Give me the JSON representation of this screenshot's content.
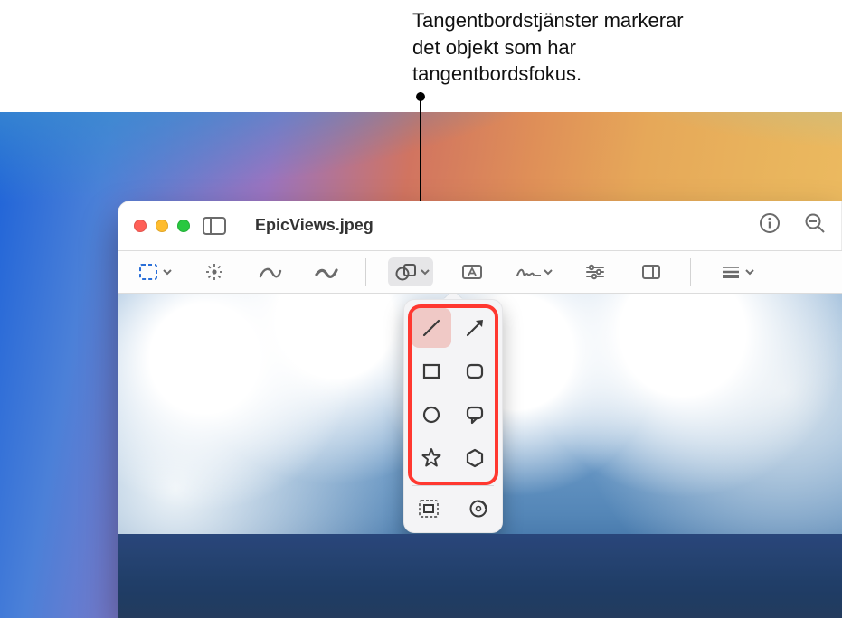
{
  "callout": {
    "text": "Tangentbordstjänster markerar det objekt som har tangentbordsfokus."
  },
  "window": {
    "title": "EpicViews.jpeg",
    "traffic": {
      "close": "close",
      "minimize": "minimize",
      "zoom": "zoom"
    },
    "sidebar_button": "sidebar",
    "info_button": "info",
    "zoom_out_button": "zoom-out"
  },
  "markup": {
    "items": [
      {
        "name": "selection-tool",
        "has_chevron": true
      },
      {
        "name": "instant-alpha-tool",
        "has_chevron": false
      },
      {
        "name": "sketch-tool",
        "has_chevron": false
      },
      {
        "name": "draw-tool",
        "has_chevron": false
      },
      {
        "name": "shapes-tool",
        "has_chevron": true,
        "active": true
      },
      {
        "name": "text-tool",
        "has_chevron": false
      },
      {
        "name": "sign-tool",
        "has_chevron": true
      },
      {
        "name": "adjust-color-tool",
        "has_chevron": false
      },
      {
        "name": "crop-tool",
        "has_chevron": false
      },
      {
        "name": "line-style-tool",
        "has_chevron": true
      }
    ]
  },
  "popover": {
    "shapes": [
      {
        "name": "line-shape",
        "focused": true
      },
      {
        "name": "arrow-shape"
      },
      {
        "name": "rectangle-shape"
      },
      {
        "name": "rounded-rectangle-shape"
      },
      {
        "name": "oval-shape"
      },
      {
        "name": "speech-bubble-shape"
      },
      {
        "name": "star-shape"
      },
      {
        "name": "polygon-shape"
      }
    ],
    "extras": [
      {
        "name": "mask-tool"
      },
      {
        "name": "loupe-tool"
      }
    ]
  },
  "colors": {
    "focus_ring": "#ff3830",
    "focused_cell_bg": "#f0c9c6"
  }
}
